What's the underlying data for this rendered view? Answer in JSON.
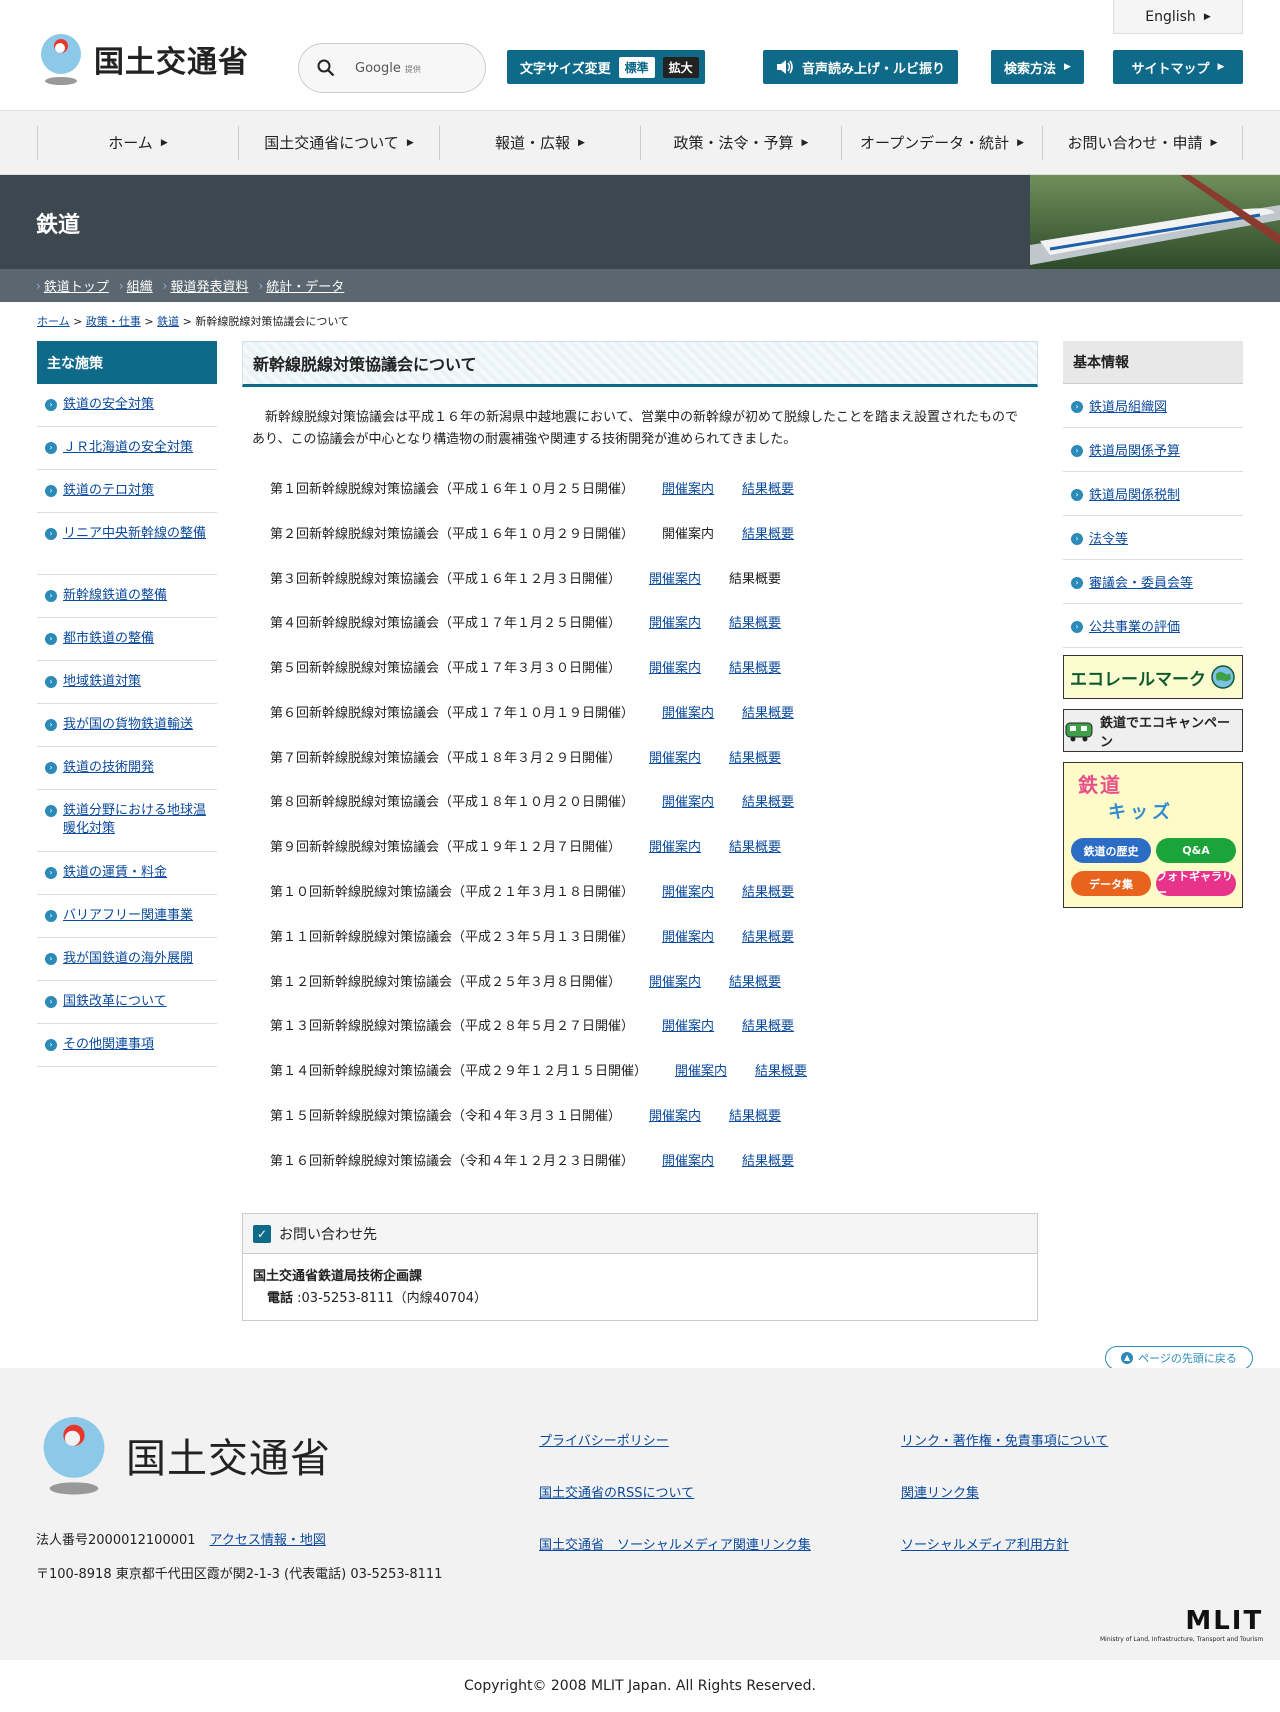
{
  "header": {
    "logo_text": "国土交通省",
    "english_label": "English",
    "search_placeholder": "Google",
    "search_provider": "提供",
    "font_size_label": "文字サイズ変更",
    "font_size_standard": "標準",
    "font_size_large": "拡大",
    "read_aloud_label": "音声読み上げ・ルビ振り",
    "search_help_label": "検索方法",
    "sitemap_label": "サイトマップ"
  },
  "gnav": [
    {
      "label": "ホーム"
    },
    {
      "label": "国土交通省について"
    },
    {
      "label": "報道・広報"
    },
    {
      "label": "政策・法令・予算"
    },
    {
      "label": "オープンデータ・統計"
    },
    {
      "label": "お問い合わせ・申請"
    }
  ],
  "section": {
    "title": "鉄道",
    "subnav": [
      "鉄道トップ",
      "組織",
      "報道発表資料",
      "統計・データ"
    ]
  },
  "breadcrumb": {
    "home": "ホーム",
    "policy": "政策・仕事",
    "railway": "鉄道",
    "current": "新幹線脱線対策協議会について",
    "sep": ">"
  },
  "left_sidebar": {
    "title": "主な施策",
    "items": [
      "鉄道の安全対策",
      "ＪＲ北海道の安全対策",
      "鉄道のテロ対策",
      "リニア中央新幹線の整備",
      "新幹線鉄道の整備",
      "都市鉄道の整備",
      "地域鉄道対策",
      "我が国の貨物鉄道輸送",
      "鉄道の技術開発",
      "鉄道分野における地球温暖化対策",
      "鉄道の運賃・料金",
      "バリアフリー関連事業",
      "我が国鉄道の海外展開",
      "国鉄改革について",
      "その他関連事項"
    ]
  },
  "main": {
    "title": "新幹線脱線対策協議会について",
    "intro": "新幹線脱線対策協議会は平成１６年の新潟県中越地震において、営業中の新幹線が初めて脱線したことを踏まえ設置されたものであり、この協議会が中心となり構造物の耐震補強や関連する技術開発が進められてきました。",
    "notice_label": "開催案内",
    "summary_label": "結果概要",
    "meetings": [
      {
        "title": "第１回新幹線脱線対策協議会（平成１６年１０月２５日開催）",
        "notice_link": true,
        "summary_link": true
      },
      {
        "title": "第２回新幹線脱線対策協議会（平成１６年１０月２９日開催）",
        "notice_link": false,
        "summary_link": true
      },
      {
        "title": "第３回新幹線脱線対策協議会（平成１６年１２月３日開催）",
        "notice_link": true,
        "summary_link": false
      },
      {
        "title": "第４回新幹線脱線対策協議会（平成１７年１月２５日開催）",
        "notice_link": true,
        "summary_link": true
      },
      {
        "title": "第５回新幹線脱線対策協議会（平成１７年３月３０日開催）",
        "notice_link": true,
        "summary_link": true
      },
      {
        "title": "第６回新幹線脱線対策協議会（平成１７年１０月１９日開催）",
        "notice_link": true,
        "summary_link": true
      },
      {
        "title": "第７回新幹線脱線対策協議会（平成１８年３月２９日開催）",
        "notice_link": true,
        "summary_link": true
      },
      {
        "title": "第８回新幹線脱線対策協議会（平成１８年１０月２０日開催）",
        "notice_link": true,
        "summary_link": true
      },
      {
        "title": "第９回新幹線脱線対策協議会（平成１９年１２月７日開催）",
        "notice_link": true,
        "summary_link": true
      },
      {
        "title": "第１０回新幹線脱線対策協議会（平成２１年３月１８日開催）",
        "notice_link": true,
        "summary_link": true
      },
      {
        "title": "第１１回新幹線脱線対策協議会（平成２３年５月１３日開催）",
        "notice_link": true,
        "summary_link": true
      },
      {
        "title": "第１２回新幹線脱線対策協議会（平成２５年３月８日開催）",
        "notice_link": true,
        "summary_link": true
      },
      {
        "title": "第１３回新幹線脱線対策協議会（平成２８年５月２７日開催）",
        "notice_link": true,
        "summary_link": true
      },
      {
        "title": "第１４回新幹線脱線対策協議会（平成２９年１２月１５日開催）",
        "notice_link": true,
        "summary_link": true
      },
      {
        "title": "第１５回新幹線脱線対策協議会（令和４年３月３１日開催）",
        "notice_link": true,
        "summary_link": true
      },
      {
        "title": "第１６回新幹線脱線対策協議会（令和４年１２月２３日開催）",
        "notice_link": true,
        "summary_link": true
      }
    ]
  },
  "contact": {
    "title": "お問い合わせ先",
    "org": "国土交通省鉄道局技術企画課",
    "tel_label": "電話",
    "tel": " :03-5253-8111（内線40704）"
  },
  "right_sidebar": {
    "title": "基本情報",
    "items": [
      "鉄道局組織図",
      "鉄道局関係予算",
      "鉄道局関係税制",
      "法令等",
      "審議会・委員会等",
      "公共事業の評価"
    ],
    "banner_eco": "エコレールマーク",
    "banner_campaign": "鉄道でエコキャンペーン",
    "kids_title": "鉄道",
    "kids_subtitle": "キッズ",
    "kids_history": "鉄道の歴史",
    "kids_qa": "Q&A",
    "kids_data": "データ集",
    "kids_gallery": "フォトギャラリー"
  },
  "pagetop_label": "ページの先頭に戻る",
  "footer": {
    "logo_text": "国土交通省",
    "corp_no": "法人番号2000012100001",
    "access": "アクセス情報・地図",
    "address": "〒100-8918 東京都千代田区霞が関2-1-3 (代表電話) 03-5253-8111",
    "links": [
      "プライバシーポリシー",
      "リンク・著作権・免責事項について",
      "国土交通省のRSSについて",
      "関連リンク集",
      "国土交通省　ソーシャルメディア関連リンク集",
      "ソーシャルメディア利用方針"
    ],
    "mlit_word": "MLIT",
    "mlit_sub": "Ministry of Land, Infrastructure, Transport and Tourism",
    "copyright": "Copyright© 2008 MLIT Japan. All Rights Reserved."
  },
  "colors": {
    "primary": "#0f6a8a",
    "banner": "#3c4750",
    "link": "#0b4a9e"
  }
}
